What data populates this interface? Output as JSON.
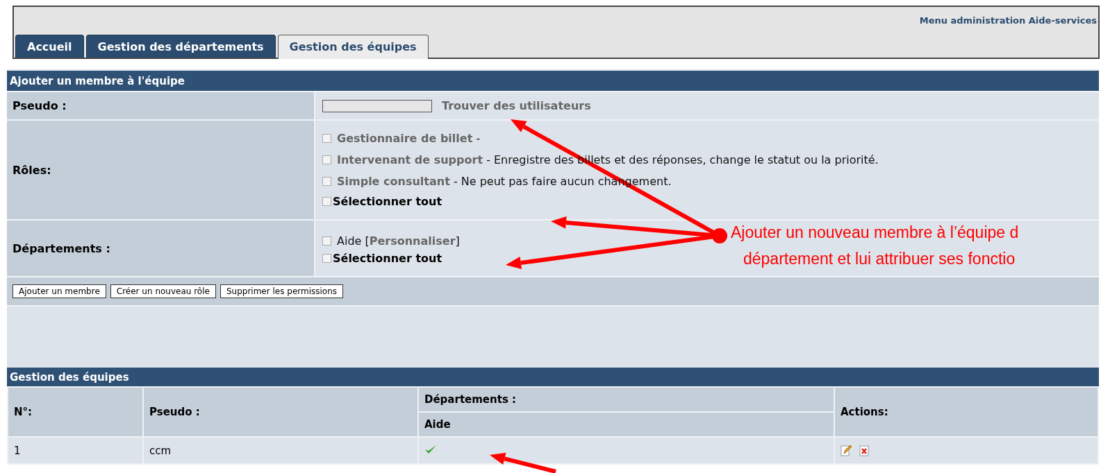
{
  "header": {
    "menu_title": "Menu administration Aide-services"
  },
  "tabs": [
    {
      "label": "Accueil",
      "selected": false
    },
    {
      "label": "Gestion des départements",
      "selected": false
    },
    {
      "label": "Gestion des équipes",
      "selected": true
    }
  ],
  "add_member": {
    "title": "Ajouter un membre à l'équipe",
    "pseudo": {
      "label": "Pseudo :",
      "link": "Trouver des utilisateurs"
    },
    "roles": {
      "label": "Rôles:",
      "options": [
        {
          "name": "Gestionnaire de billet",
          "description": "-",
          "checked": false
        },
        {
          "name": "Intervenant de support",
          "description": "- Enregistre des billets et des réponses, change le statut ou la priorité.",
          "checked": false
        },
        {
          "name": "Simple consultant",
          "description": "- Ne peut pas faire aucun changement.",
          "checked": false
        }
      ],
      "select_all": {
        "label": "Sélectionner tout",
        "checked": false
      }
    },
    "departments": {
      "label": "Départements :",
      "options": [
        {
          "label": "Aide [**Personnaliser**]",
          "checked": false
        }
      ],
      "select_all": {
        "label": "Sélectionner tout",
        "checked": false
      }
    },
    "buttons": [
      "Ajouter un membre",
      "Créer un nouveau rôle",
      "Supprimer les permissions"
    ]
  },
  "teams_table": {
    "title": "Gestion des équipes",
    "columns": [
      "N°:",
      "Pseudo :",
      "Départements :",
      "Actions:"
    ],
    "department_columns": [
      "Aide"
    ],
    "rows": [
      {
        "number": "1",
        "pseudo": "ccm",
        "departments": [
          {
            "checked": true
          }
        ]
      }
    ]
  },
  "annotation": {
    "lines": [
      "Ajouter un nouveau membre à l’équipe d",
      "département et lui attribuer ses fonctio"
    ]
  }
}
